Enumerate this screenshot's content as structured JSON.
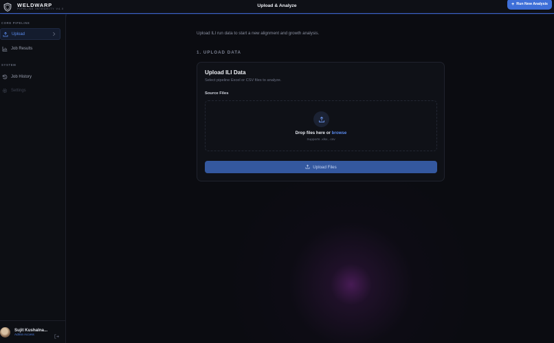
{
  "brand": {
    "name": "WELDWARP",
    "subtitle": "PIPELINE INTEGRITY V4.0"
  },
  "header": {
    "title": "Upload & Analyze",
    "run_button": "Run New Analysis"
  },
  "sidebar": {
    "core_label": "CORE PIPELINE",
    "system_label": "SYSTEM",
    "items": [
      {
        "label": "Upload",
        "icon": "upload-icon",
        "active": true
      },
      {
        "label": "Job Results",
        "icon": "bar-chart-icon"
      },
      {
        "label": "Job History",
        "icon": "history-icon"
      },
      {
        "label": "Settings",
        "icon": "gear-icon"
      }
    ]
  },
  "user": {
    "name": "Sujit Kushalna...",
    "role": "Admin Access"
  },
  "main": {
    "intro": "Upload ILI run data to start a new alignment and growth analysis.",
    "step_title": "1. UPLOAD DATA",
    "card": {
      "title": "Upload ILI Data",
      "subtitle": "Select pipeline Excel or CSV files to analyze.",
      "files_label": "Source Files",
      "drop_text": "Drop files here or",
      "browse": "browse",
      "hint": "Supports .xlsx, .csv",
      "upload_button": "Upload Files"
    }
  },
  "colors": {
    "accent": "#3e6fd8",
    "link": "#5b8cf0",
    "background": "#0b0c11"
  }
}
